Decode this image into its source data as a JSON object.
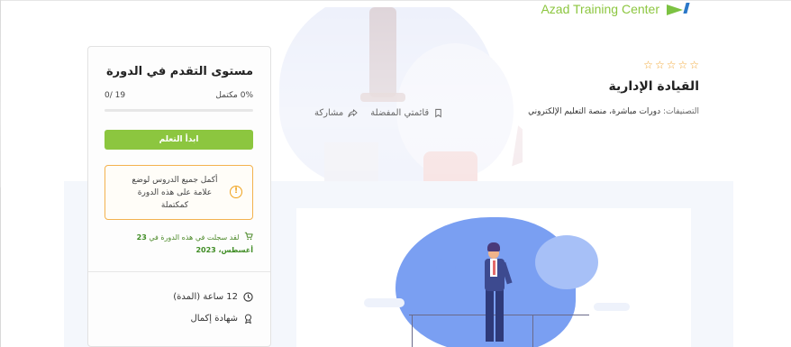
{
  "brand": {
    "name": "Azad Training Center"
  },
  "course": {
    "rating_stars": [
      "☆",
      "☆",
      "☆",
      "☆",
      "☆"
    ],
    "title": "القيادة الإدارية",
    "categories_label": "التصنيفات:",
    "categories_value": "دورات مباشرة، منصة التعليم الإلكتروني",
    "wishlist_label": "قائمتي المفضلة",
    "share_label": "مشاركة"
  },
  "progress_card": {
    "title": "مستوى التقدم في الدورة",
    "percent_label": "0% مكتمل",
    "lessons_count": "0/ 19",
    "progress_fraction": 0,
    "start_button": "ابدأ التعلم",
    "notice": "أكمل جميع الدروس لوضع علامة على هذه الدورة كمكتملة",
    "enrolled_prefix": "لقد سجلت في هذه الدورة في",
    "enrolled_date": "23 أغسطس، 2023",
    "duration": "12 ساعة (المدة)",
    "certificate": "شهادة إكمال"
  },
  "colors": {
    "accent_green": "#8cc63f",
    "warning_orange": "#f3b24e",
    "star_orange": "#f1a42f",
    "illustration_blue": "#7a9ff2"
  },
  "icons": {
    "star": "star-outline-icon",
    "wishlist": "bookmark-icon",
    "share": "share-icon",
    "notice": "exclamation-circle-icon",
    "enrolled": "cart-icon",
    "duration": "clock-icon",
    "certificate": "badge-icon"
  }
}
